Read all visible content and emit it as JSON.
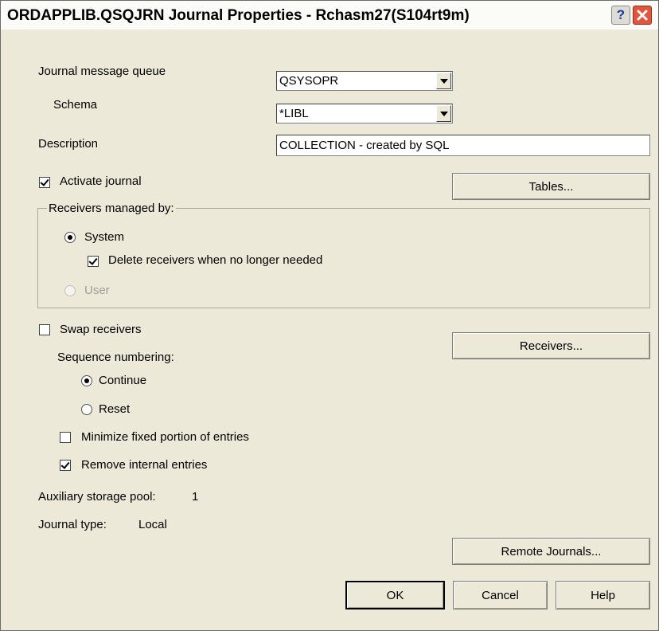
{
  "window": {
    "title": "ORDAPPLIB.QSQJRN Journal Properties - Rchasm27(S104rt9m)",
    "help_glyph": "?",
    "close_glyph": "✕"
  },
  "form": {
    "journal_message_queue": {
      "label": "Journal message queue",
      "value": "QSYSOPR"
    },
    "schema": {
      "label": "Schema",
      "value": "*LIBL"
    },
    "description": {
      "label": "Description",
      "value": "COLLECTION - created by SQL"
    },
    "activate_journal": {
      "label": "Activate journal",
      "checked": true
    },
    "tables_button": "Tables...",
    "receivers_group": {
      "label": "Receivers managed by:",
      "system": {
        "label": "System",
        "selected": true
      },
      "delete_receivers": {
        "label": "Delete receivers when no longer needed",
        "checked": true
      },
      "user": {
        "label": "User",
        "selected": false,
        "disabled": true
      }
    },
    "swap_receivers": {
      "label": "Swap receivers",
      "checked": false
    },
    "receivers_button": "Receivers...",
    "sequence_numbering": {
      "label": "Sequence numbering:",
      "continue": {
        "label": "Continue",
        "selected": true
      },
      "reset": {
        "label": "Reset",
        "selected": false
      }
    },
    "minimize_fixed": {
      "label": "Minimize fixed portion of entries",
      "checked": false
    },
    "remove_internal": {
      "label": "Remove internal entries",
      "checked": true
    },
    "auxiliary_storage_pool": {
      "label": "Auxiliary storage pool:",
      "value": "1"
    },
    "journal_type": {
      "label": "Journal type:",
      "value": "Local"
    },
    "remote_journals_button": "Remote Journals..."
  },
  "buttons": {
    "ok": "OK",
    "cancel": "Cancel",
    "help": "Help"
  }
}
